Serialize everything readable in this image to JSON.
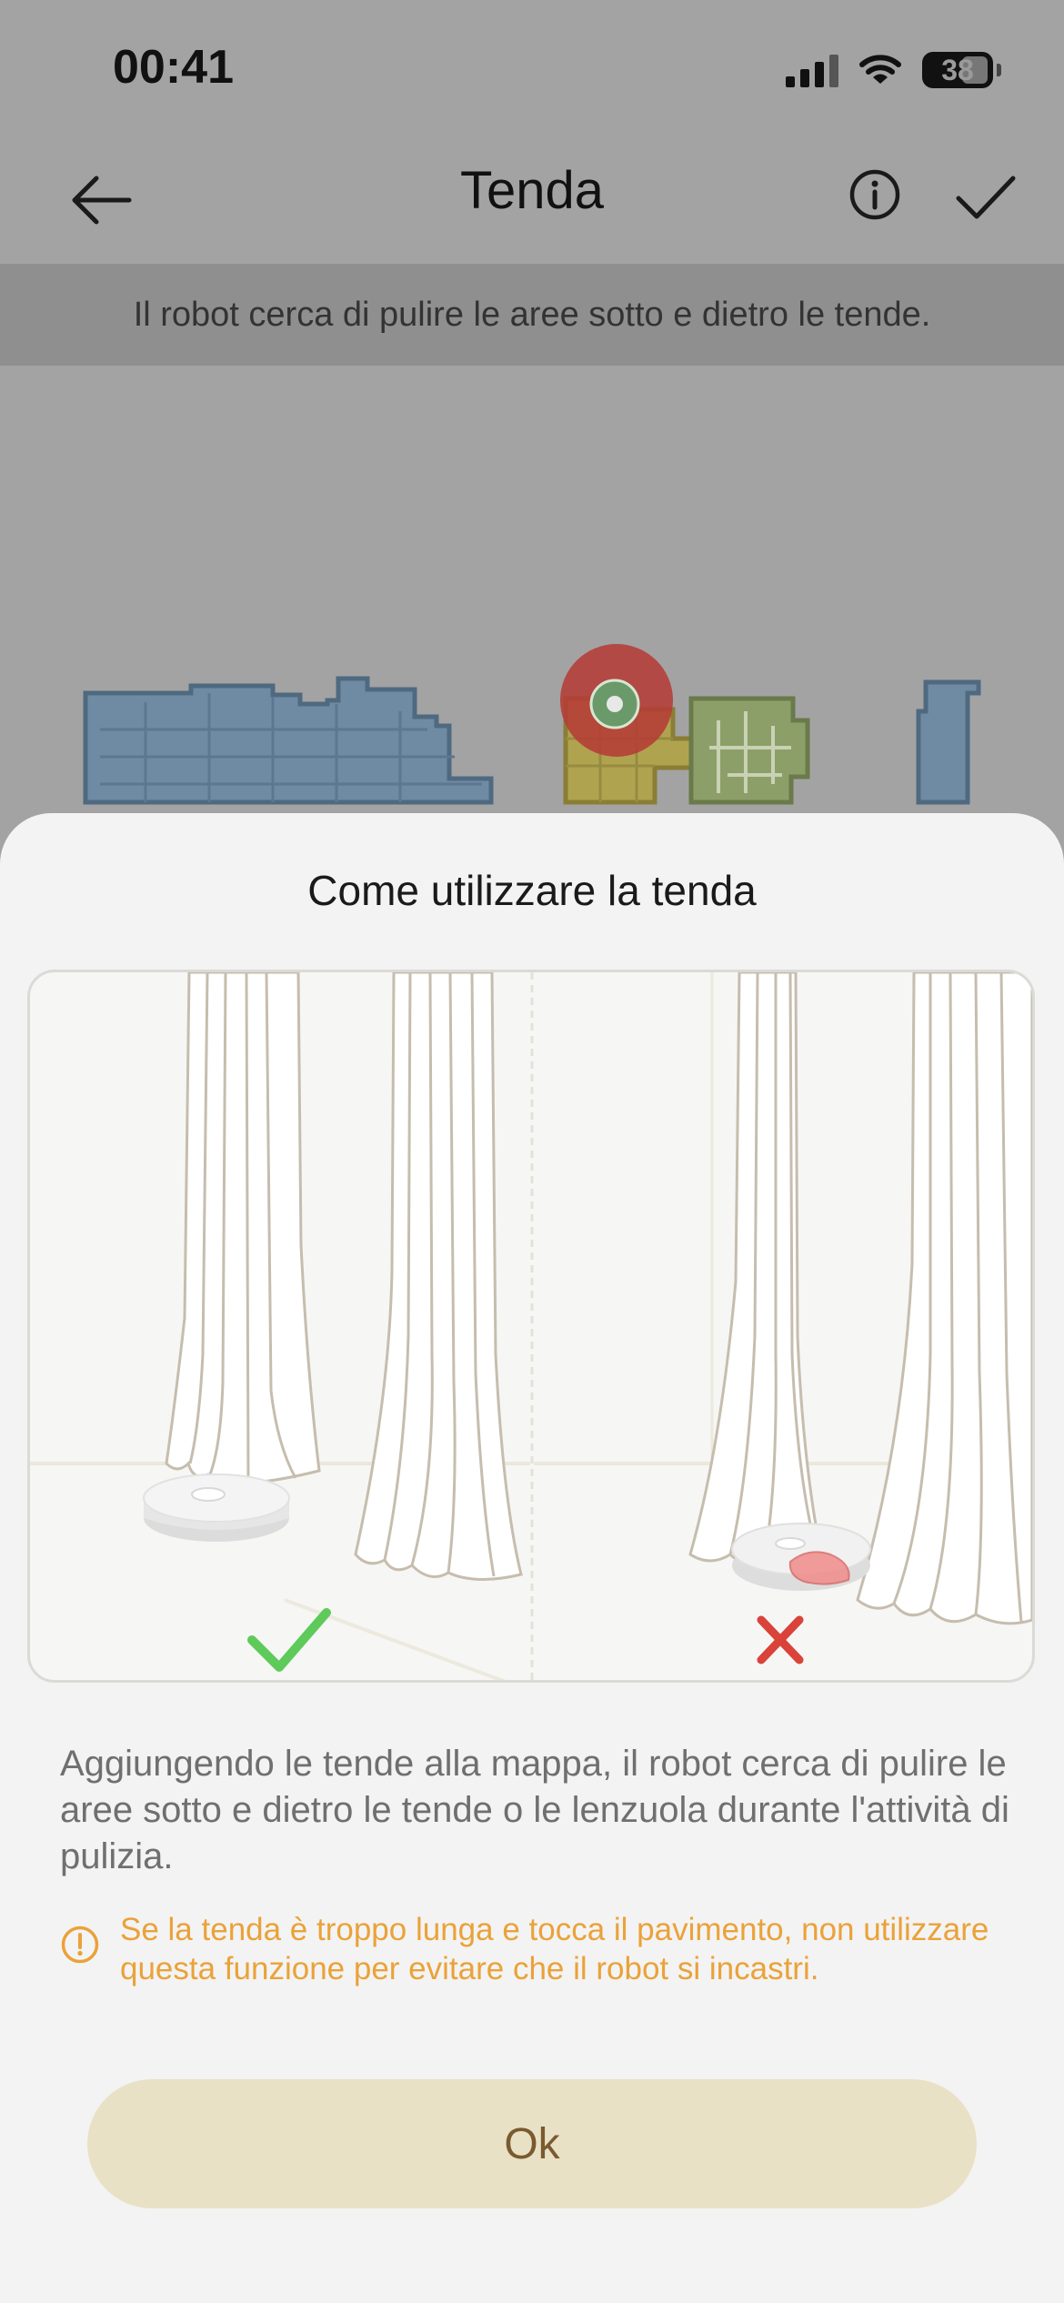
{
  "status_bar": {
    "time": "00:41",
    "battery": "38"
  },
  "nav": {
    "title": "Tenda"
  },
  "banner": {
    "text": "Il robot cerca di pulire le aree sotto e dietro le tende."
  },
  "sheet": {
    "title": "Come utilizzare la tenda",
    "description": "Aggiungendo le tende alla mappa, il robot cerca di pulire le aree sotto e dietro le tende o le lenzuola durante l'attività di pulizia.",
    "warning": "Se la tenda è troppo lunga e tocca il pavimento, non utilizzare questa funzione per evitare che il robot si incastri.",
    "ok_label": "Ok"
  },
  "colors": {
    "accent": "#eaa239",
    "button_bg": "#e9e1c6",
    "button_text": "#7a5a2f",
    "correct": "#5dca5a",
    "wrong": "#d9433a",
    "map_room_blue": "#6f8aa3",
    "map_room_yellow": "#b0a350",
    "map_room_green": "#8d9f69",
    "robot_marker": "#b53a35"
  },
  "icons": {
    "back": "arrow-left-icon",
    "info": "info-icon",
    "confirm": "checkmark-icon",
    "warning": "warning-circle-icon",
    "correct": "green-check-icon",
    "wrong": "red-cross-icon"
  }
}
